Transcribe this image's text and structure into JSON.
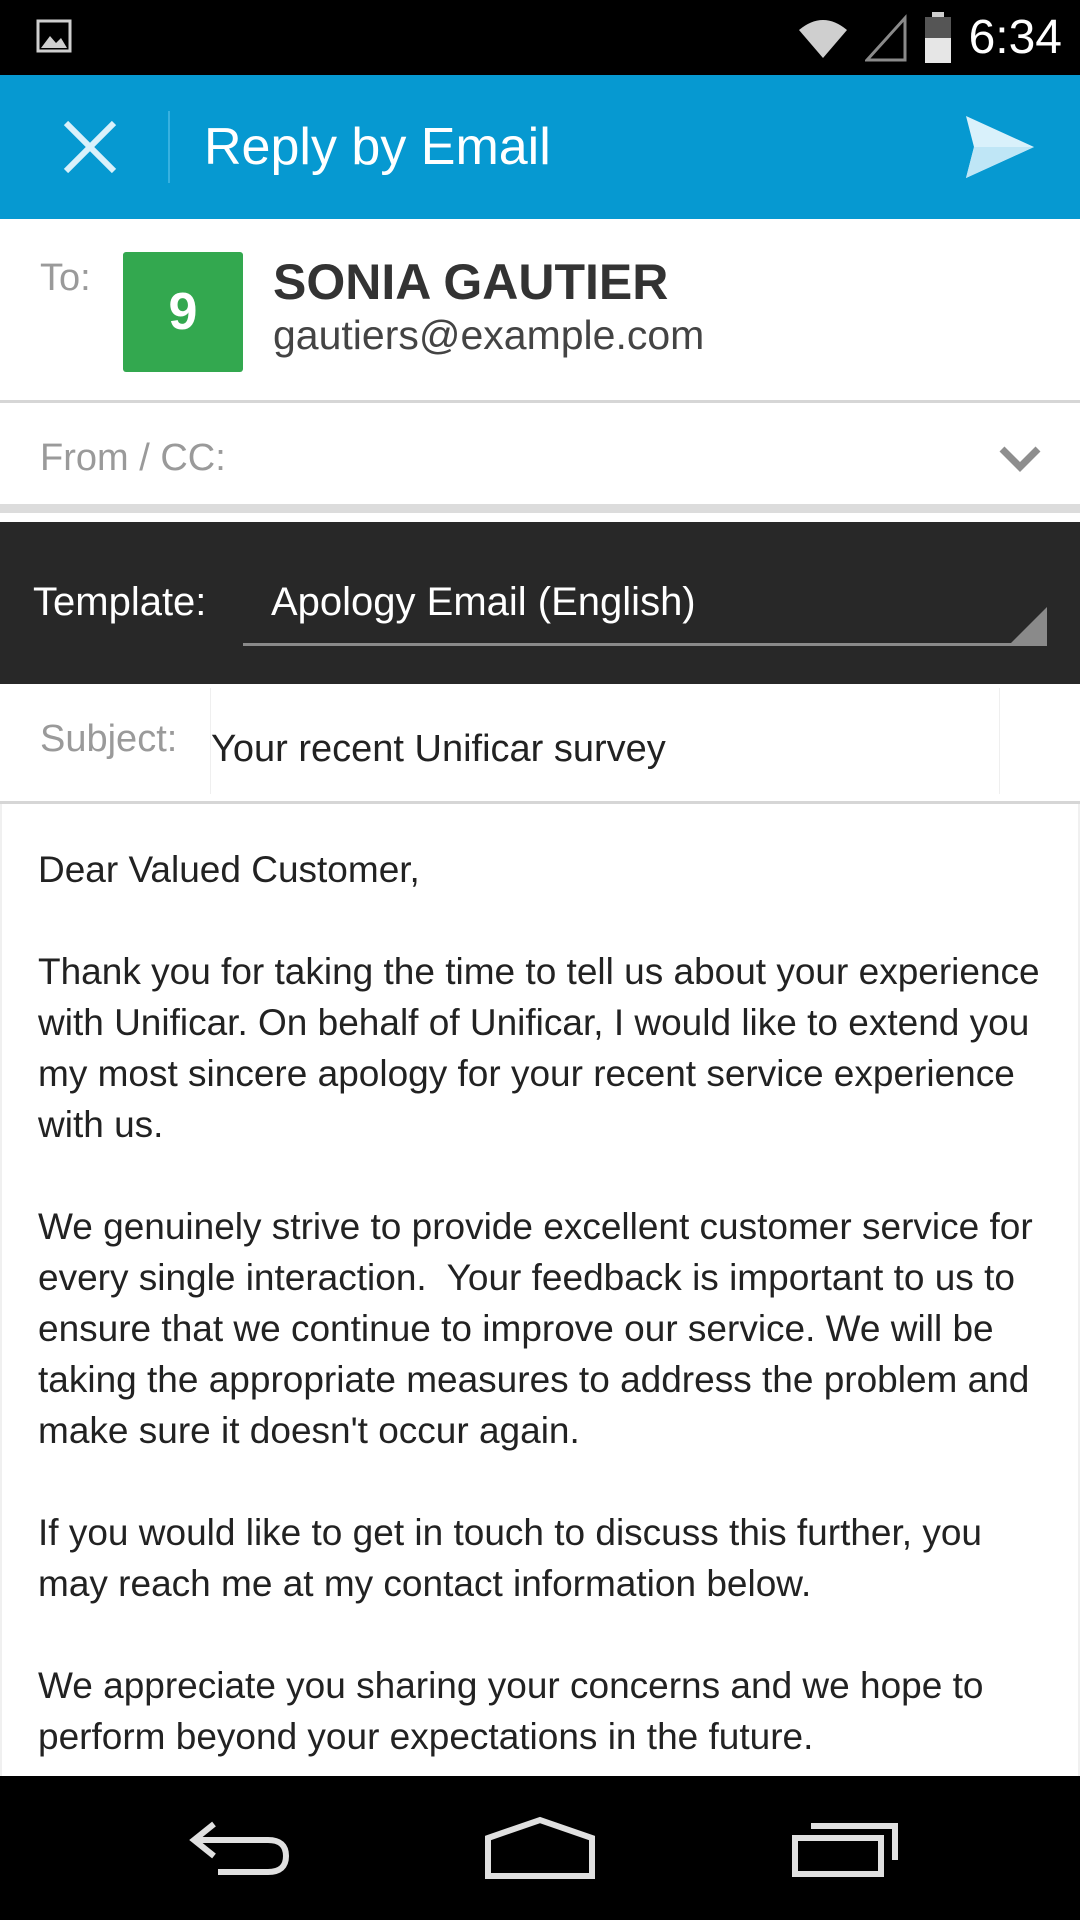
{
  "status_bar": {
    "time": "6:34",
    "icons": [
      "image-notification-icon",
      "wifi-icon",
      "signal-icon",
      "battery-icon"
    ]
  },
  "action_bar": {
    "title": "Reply by Email",
    "close_icon": "close-icon",
    "send_icon": "send-icon",
    "color": "#0699d1"
  },
  "to": {
    "label": "To:",
    "avatar_text": "9",
    "avatar_color": "#33a84f",
    "name": "SONIA GAUTIER",
    "email": "gautiers@example.com"
  },
  "from_cc": {
    "label": "From / CC:"
  },
  "template": {
    "label": "Template:",
    "value": "Apology Email (English)"
  },
  "subject": {
    "label": "Subject:",
    "value": "Your recent Unificar survey"
  },
  "body": {
    "paragraphs": [
      "Dear Valued Customer,",
      "Thank you for taking the time to tell us about your experience with Unificar. On behalf of Unificar, I would like to extend you my most sincere apology for your recent service experience with us.",
      "We genuinely strive to provide excellent customer service for every single interaction.  Your feedback is important to us to ensure that we continue to improve our service. We will be taking the appropriate measures to address the problem and make sure it doesn't occur again.",
      "If you would like to get in touch to discuss this further, you may reach me at my contact information below.",
      "We appreciate you sharing your concerns and we hope to perform beyond your expectations in the future."
    ]
  },
  "nav_bar": {
    "icons": [
      "back-icon",
      "home-icon",
      "recent-apps-icon"
    ]
  }
}
